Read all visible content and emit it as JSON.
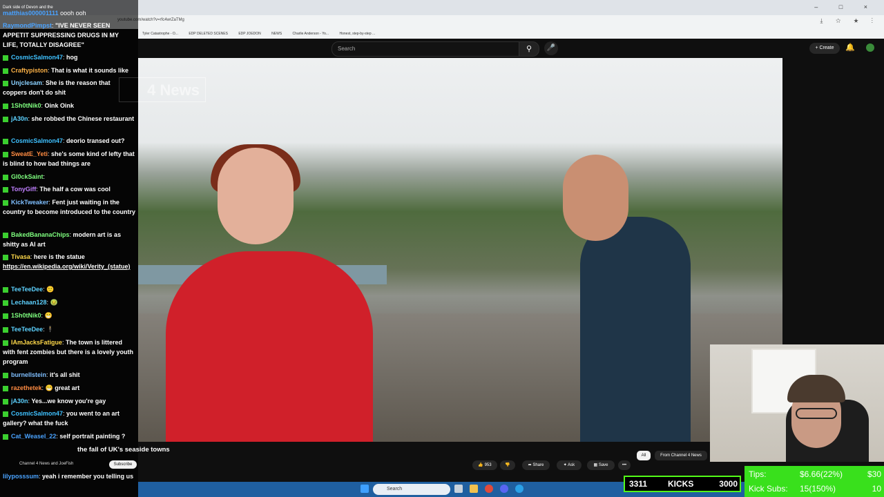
{
  "browser": {
    "url": "youtube.com/watch?v=rfc4wrZaTMg",
    "bookmarks": [
      "Tyler Catastrophe - O...",
      "EDP DELETED SCENES",
      "EDP JOEDON",
      "NEWS",
      "Charlie Anderson - Yo...",
      "Honest, step-by-step ..."
    ],
    "window_controls": [
      "–",
      "□",
      "×"
    ],
    "toolbar_icons": [
      "⤓",
      "☆",
      "★",
      "⋮"
    ]
  },
  "youtube": {
    "search_placeholder": "Search",
    "create_label": "+ Create",
    "video_logo_text": "4 News",
    "video_title_suffix": "the fall of UK's seaside towns",
    "channel_names": "Channel 4 News and JoeFish",
    "subscribe_label": "Subscribe",
    "like_count": "953",
    "share_label": "Share",
    "ask_label": "Ask",
    "save_label": "Save",
    "more_label": "•••",
    "chip_all": "All",
    "chip_channel": "From Channel 4 News"
  },
  "chat": {
    "header_line": "Dark side of Devon and the",
    "messages": [
      {
        "user": "matthias000001111",
        "text": "oooh ooh"
      },
      {
        "user": "RaymondPimpst",
        "text": "\"IVE NEVER SEEN APPETIT SUPPRESSING DRUGS IN MY LIFE, TOTALLY DISAGREE\""
      },
      {
        "user": "CosmicSalmon47",
        "text": "hog"
      },
      {
        "user": "Craftypiston",
        "text": "That is what it sounds like"
      },
      {
        "user": "Unjclesam",
        "text": "She is the reason that coppers don't do shit"
      },
      {
        "user": "1Sh0tNik0",
        "text": "Oink Oink"
      },
      {
        "user": "jA30n",
        "text": "she robbed the Chinese restaurant"
      },
      {
        "user": "CosmicSalmon47",
        "text": "deorio transed out?"
      },
      {
        "user": "SweatE_Yeti",
        "text": "she's some kind of lefty that is blind to how bad things are"
      },
      {
        "user": "Gl0ckSaint",
        "text": ""
      },
      {
        "user": "TonyGiff",
        "text": "The half a cow was cool"
      },
      {
        "user": "KickTweaker",
        "text": "Fent just waiting in the country to become introduced to the country"
      },
      {
        "user": "BakedBananaChips",
        "text": "modern art is as shitty as AI art"
      },
      {
        "user": "Tivasa",
        "text": "here is the statue"
      },
      {
        "user": "",
        "text": "https://en.wikipedia.org/wiki/Verity_(statue)"
      },
      {
        "user": "TeeTeeDee",
        "text": ""
      },
      {
        "user": "Lechaan128",
        "text": ""
      },
      {
        "user": "1Sh0tNik0",
        "text": ""
      },
      {
        "user": "TeeTeeDee",
        "text": ""
      },
      {
        "user": "IAmJacksFatigue",
        "text": "The town is littered with fent zombies but there is a lovely youth program"
      },
      {
        "user": "burnellstein",
        "text": "it's all shit"
      },
      {
        "user": "razethetek",
        "text": "great art"
      },
      {
        "user": "jA30n",
        "text": "Yes...we know you're gay"
      },
      {
        "user": "CosmicSalmon47",
        "text": "you went to an art gallery? what the fuck"
      },
      {
        "user": "Cat_Weasel_22",
        "text": "self portrait painting ?"
      },
      {
        "user": "lilyposssum",
        "text": "yeah i remember you telling us"
      }
    ]
  },
  "stream": {
    "kicks_left": "3311",
    "kicks_label": "KICKS",
    "kicks_goal": "3000",
    "tips_label": "Tips:",
    "tips_value": "$6.66(22%)",
    "tips_goal": "$30",
    "subs_label": "Kick Subs:",
    "subs_value": "15(150%)",
    "subs_goal": "10"
  },
  "taskbar": {
    "search_label": "Search"
  },
  "colors": {
    "kick_green": "#53fc18",
    "chat_badge": "#3bcf2f",
    "taskbar_blue": "#1f5fa0"
  }
}
